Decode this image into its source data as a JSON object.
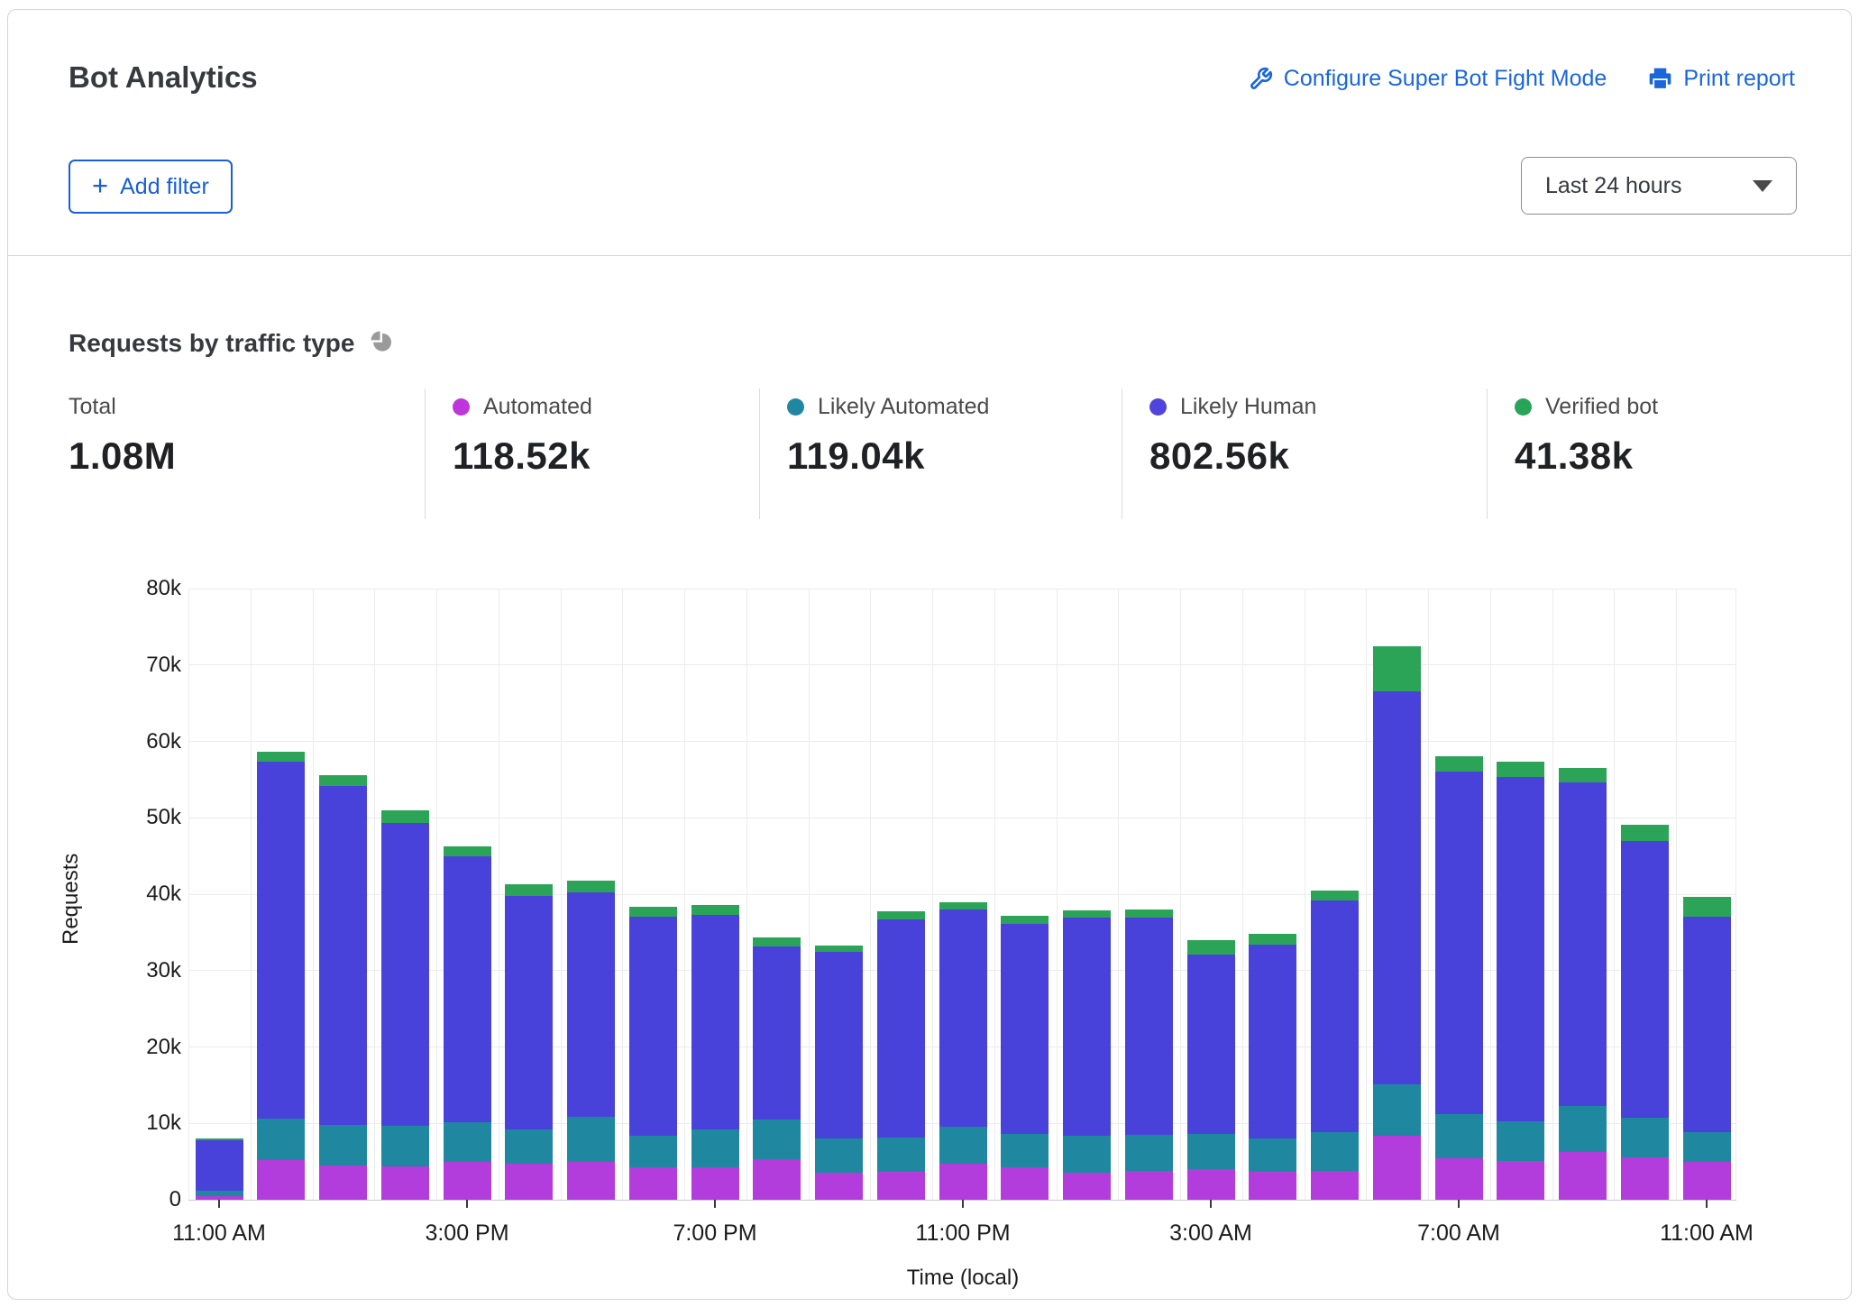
{
  "header": {
    "title": "Bot Analytics",
    "configure_label": "Configure Super Bot Fight Mode",
    "print_label": "Print report",
    "add_filter_label": "Add filter",
    "time_range": "Last 24 hours",
    "accent_color": "#1a66db"
  },
  "section": {
    "title": "Requests by traffic type"
  },
  "stats": [
    {
      "label": "Total",
      "value": "1.08M",
      "dot_color": null
    },
    {
      "label": "Automated",
      "value": "118.52k",
      "dot_color": "#be35dc"
    },
    {
      "label": "Likely Automated",
      "value": "119.04k",
      "dot_color": "#1f87a0"
    },
    {
      "label": "Likely Human",
      "value": "802.56k",
      "dot_color": "#4f44dd"
    },
    {
      "label": "Verified bot",
      "value": "41.38k",
      "dot_color": "#27a457"
    }
  ],
  "chart_data": {
    "type": "bar",
    "stacked": true,
    "title": "Requests by traffic type",
    "xlabel": "Time (local)",
    "ylabel": "Requests",
    "ylim": [
      0,
      80000
    ],
    "grid": true,
    "categories": [
      "11:00 AM",
      "12:00 PM",
      "1:00 PM",
      "2:00 PM",
      "3:00 PM",
      "4:00 PM",
      "5:00 PM",
      "6:00 PM",
      "7:00 PM",
      "8:00 PM",
      "9:00 PM",
      "10:00 PM",
      "11:00 PM",
      "12:00 AM",
      "1:00 AM",
      "2:00 AM",
      "3:00 AM",
      "4:00 AM",
      "5:00 AM",
      "6:00 AM",
      "7:00 AM",
      "8:00 AM",
      "9:00 AM",
      "10:00 AM",
      "11:00 AM"
    ],
    "xtick_indices": [
      0,
      4,
      8,
      12,
      16,
      20,
      24
    ],
    "yticks": [
      {
        "label": "0",
        "value": 0
      },
      {
        "label": "10k",
        "value": 10000
      },
      {
        "label": "20k",
        "value": 20000
      },
      {
        "label": "30k",
        "value": 30000
      },
      {
        "label": "40k",
        "value": 40000
      },
      {
        "label": "50k",
        "value": 50000
      },
      {
        "label": "60k",
        "value": 60000
      },
      {
        "label": "70k",
        "value": 70000
      },
      {
        "label": "80k",
        "value": 80000
      }
    ],
    "series": [
      {
        "name": "Automated",
        "color": "#b23cdc",
        "values": [
          500,
          5200,
          4500,
          4400,
          5000,
          4700,
          5000,
          4200,
          4300,
          5300,
          3600,
          3700,
          4700,
          4200,
          3600,
          3800,
          4000,
          3700,
          3800,
          8400,
          5400,
          5100,
          6200,
          5600,
          5000
        ]
      },
      {
        "name": "Likely Automated",
        "color": "#1f87a0",
        "values": [
          700,
          5400,
          5300,
          5300,
          5200,
          4500,
          5800,
          4200,
          4900,
          5200,
          4400,
          4400,
          4900,
          4400,
          4800,
          4700,
          4600,
          4300,
          5000,
          6700,
          5800,
          5200,
          6100,
          5100,
          3900
        ]
      },
      {
        "name": "Likely Human",
        "color": "#4942da",
        "values": [
          6600,
          46700,
          44400,
          39600,
          34800,
          30600,
          29400,
          28600,
          28100,
          22700,
          24400,
          28600,
          28400,
          27500,
          28500,
          28400,
          23500,
          25400,
          30400,
          51500,
          44800,
          45100,
          42300,
          36300,
          28100
        ]
      },
      {
        "name": "Verified bot",
        "color": "#2ca458",
        "values": [
          250,
          1300,
          1400,
          1700,
          1300,
          1500,
          1600,
          1300,
          1300,
          1100,
          900,
          1100,
          900,
          1100,
          1000,
          1100,
          1900,
          1400,
          1300,
          5800,
          2000,
          2000,
          1900,
          2100,
          2600
        ]
      }
    ]
  }
}
